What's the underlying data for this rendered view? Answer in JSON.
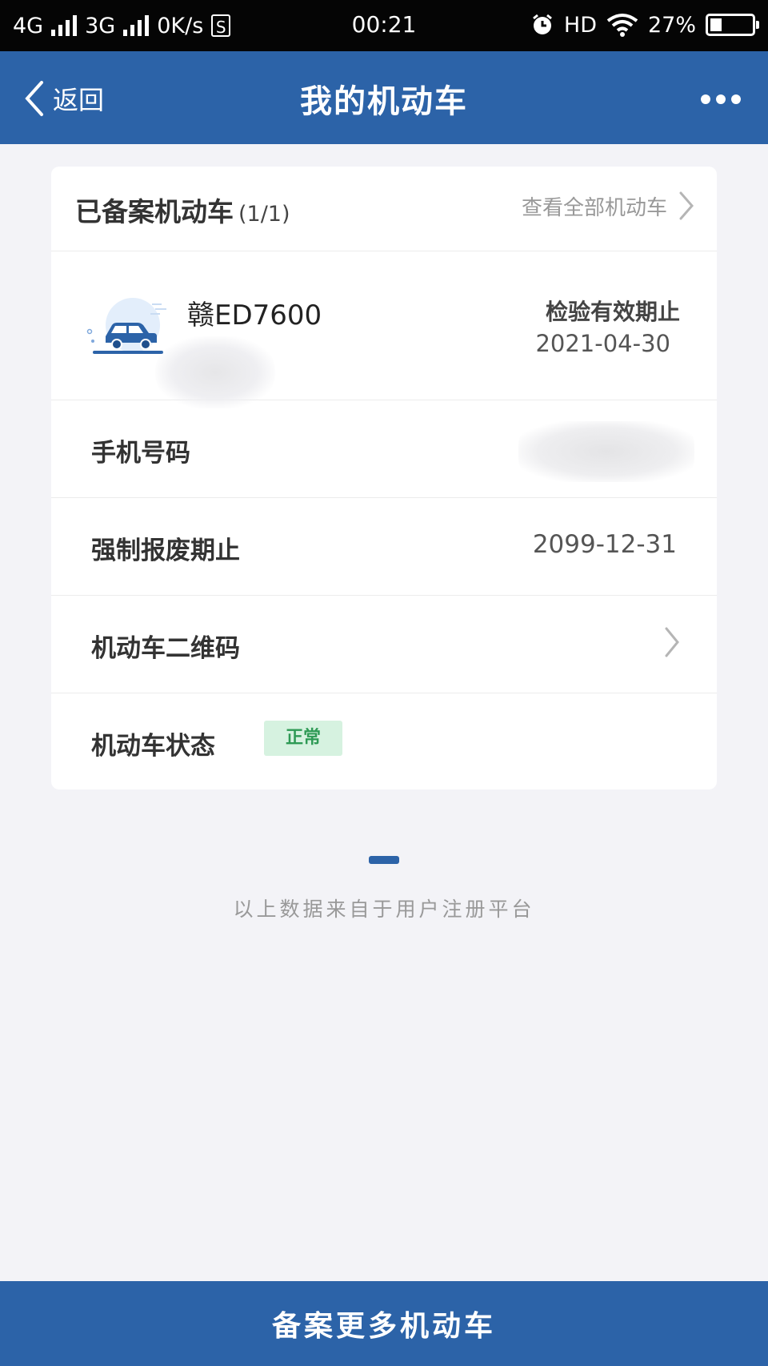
{
  "status_bar": {
    "network1": "4G",
    "network2": "3G",
    "speed": "0K/s",
    "sim_icon_text": "S",
    "time": "00:21",
    "hd": "HD",
    "battery": "27%",
    "battery_level": 0.27
  },
  "appbar": {
    "back_label": "返回",
    "title": "我的机动车"
  },
  "card": {
    "header_title": "已备案机动车",
    "header_count": "(1/1)",
    "view_all": "查看全部机动车",
    "vehicle": {
      "plate": "赣ED7600",
      "inspection_label": "检验有效期止",
      "inspection_date": "2021-04-30"
    },
    "rows": {
      "phone_label": "手机号码",
      "scrap_label": "强制报废期止",
      "scrap_date": "2099-12-31",
      "qrcode_label": "机动车二维码",
      "status_label": "机动车状态",
      "status_value": "正常"
    }
  },
  "footer_note": "以上数据来自于用户注册平台",
  "bottom_button": "备案更多机动车",
  "colors": {
    "primary": "#2c63a8",
    "status_bg": "#d6f2e0",
    "status_text": "#2e9a55",
    "page_bg": "#f3f3f7"
  }
}
